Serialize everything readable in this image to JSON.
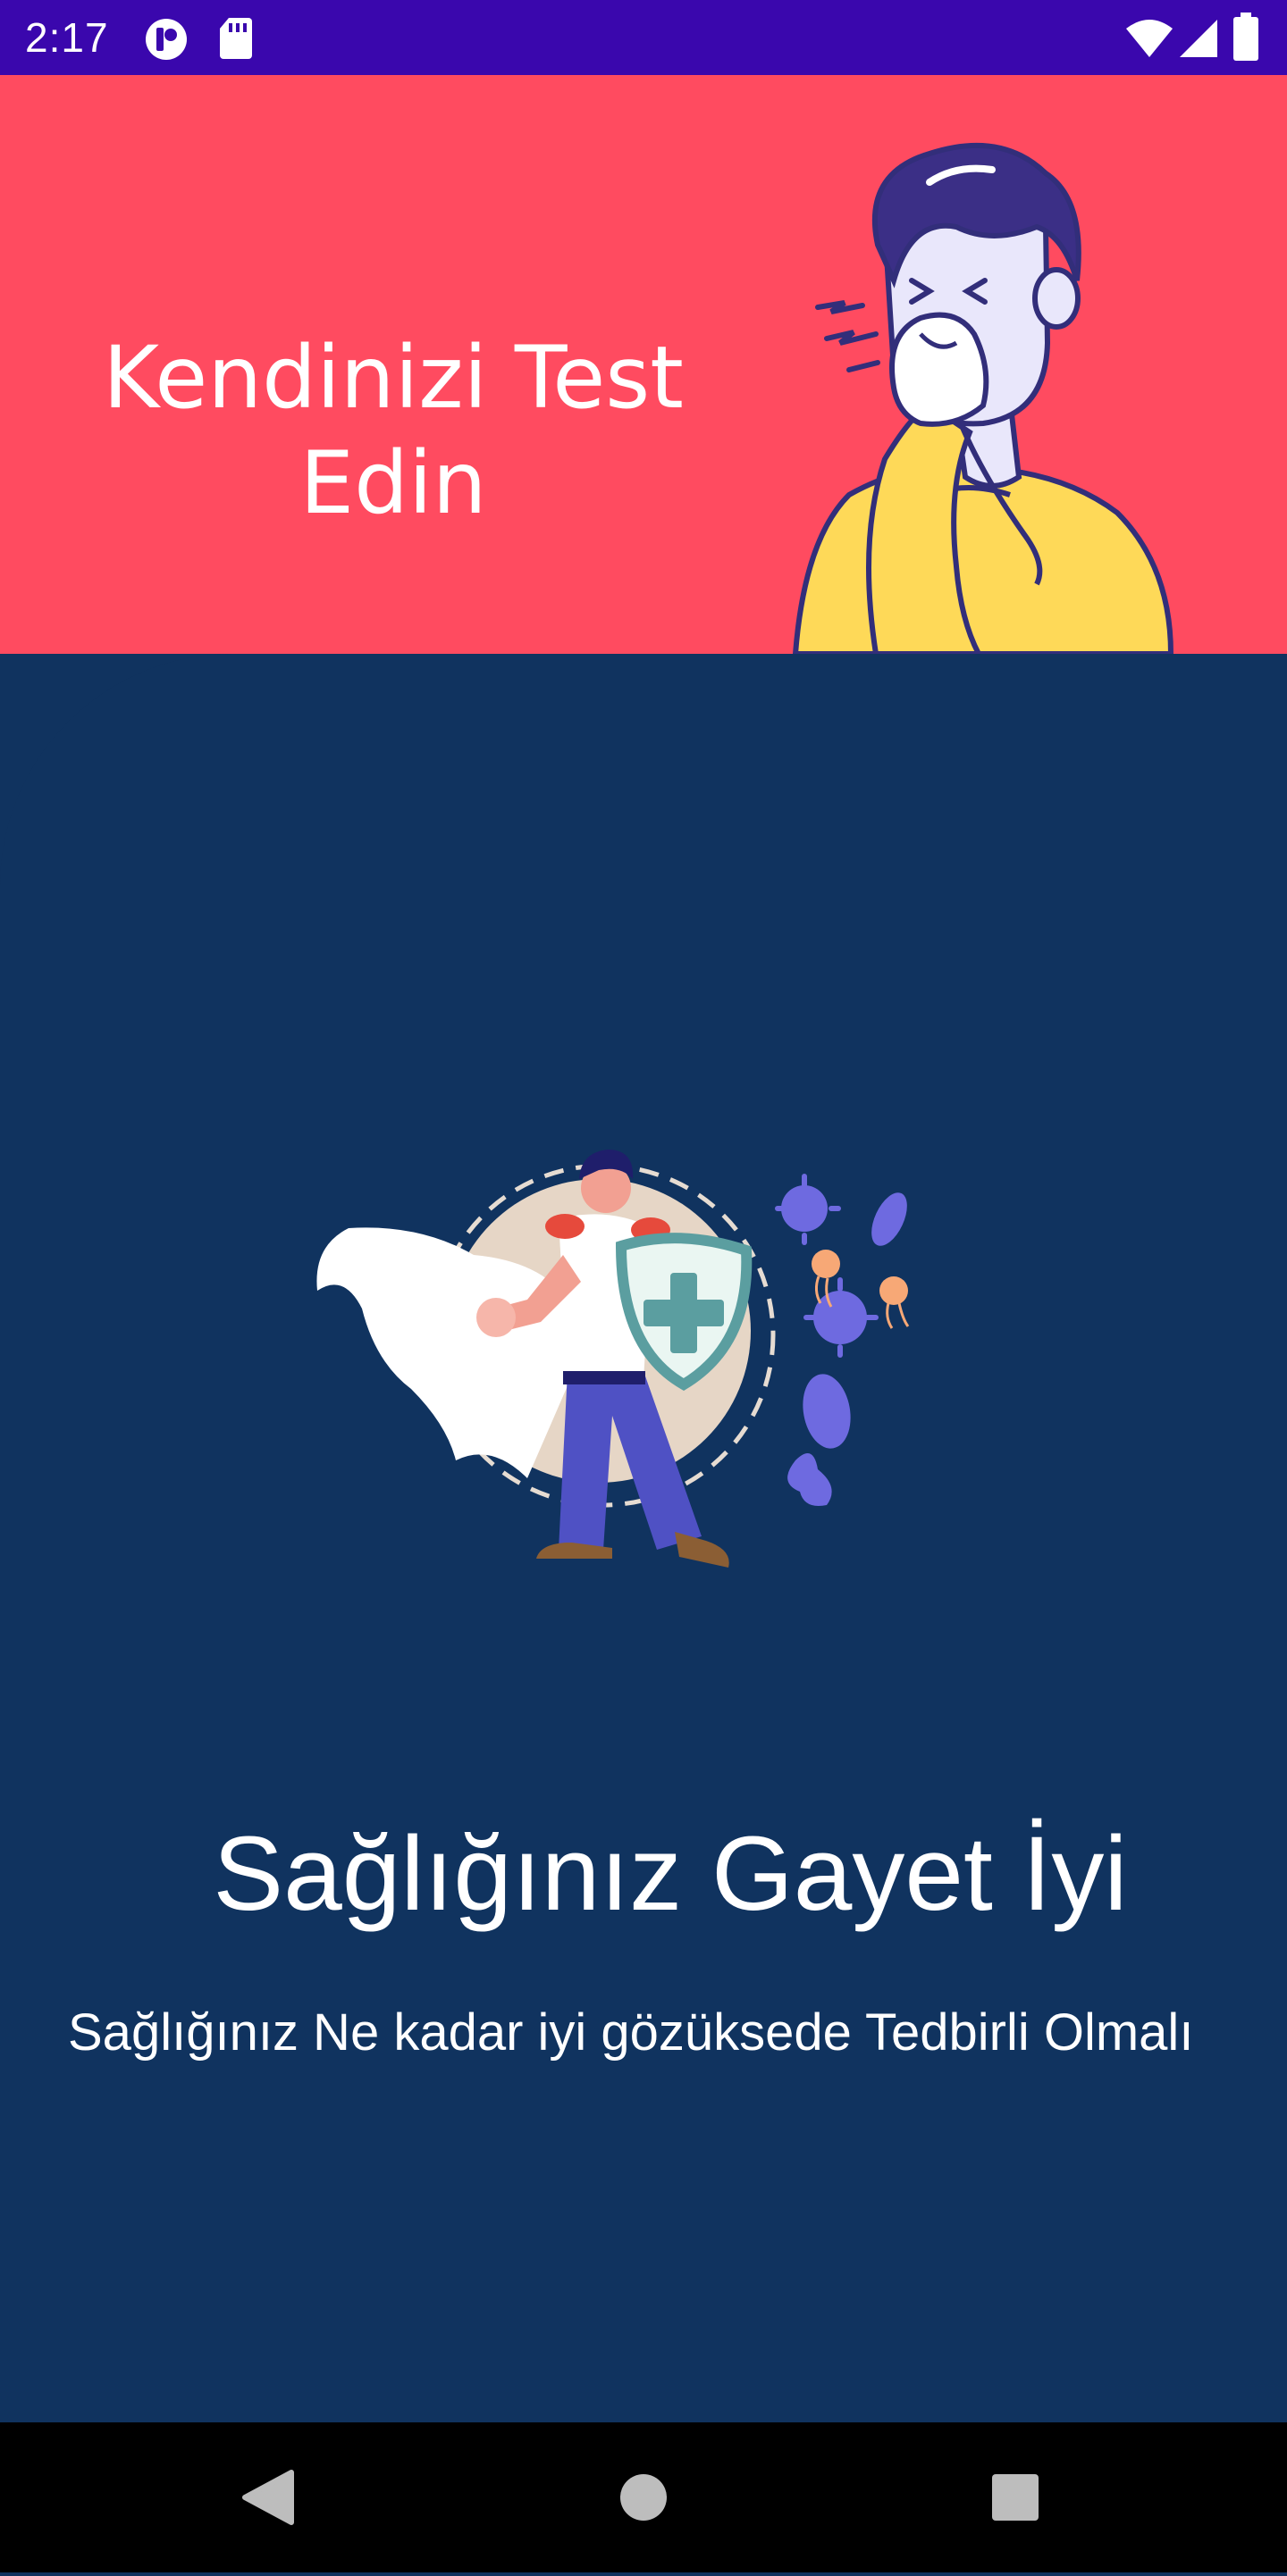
{
  "status_bar": {
    "time": "2:17",
    "left_icons": [
      "app-notification-icon",
      "sd-card-icon"
    ],
    "right_icons": [
      "wifi-icon",
      "cell-signal-icon",
      "battery-icon"
    ],
    "color": "#3a07ad"
  },
  "header": {
    "title": "Kendinizi Test\nEdin",
    "illustration": "sneezing-man-illustration",
    "color": "#ff4b60"
  },
  "content": {
    "illustration": "hero-shield-vs-viruses-illustration",
    "heading": "Sağlığınız Gayet İyi",
    "subtext": "Sağlığınız Ne kadar iyi gözüksede Tedbirli Olmalı",
    "color": "#10335f"
  },
  "nav_bar": {
    "buttons": [
      "back-icon",
      "home-icon",
      "recents-icon"
    ]
  }
}
